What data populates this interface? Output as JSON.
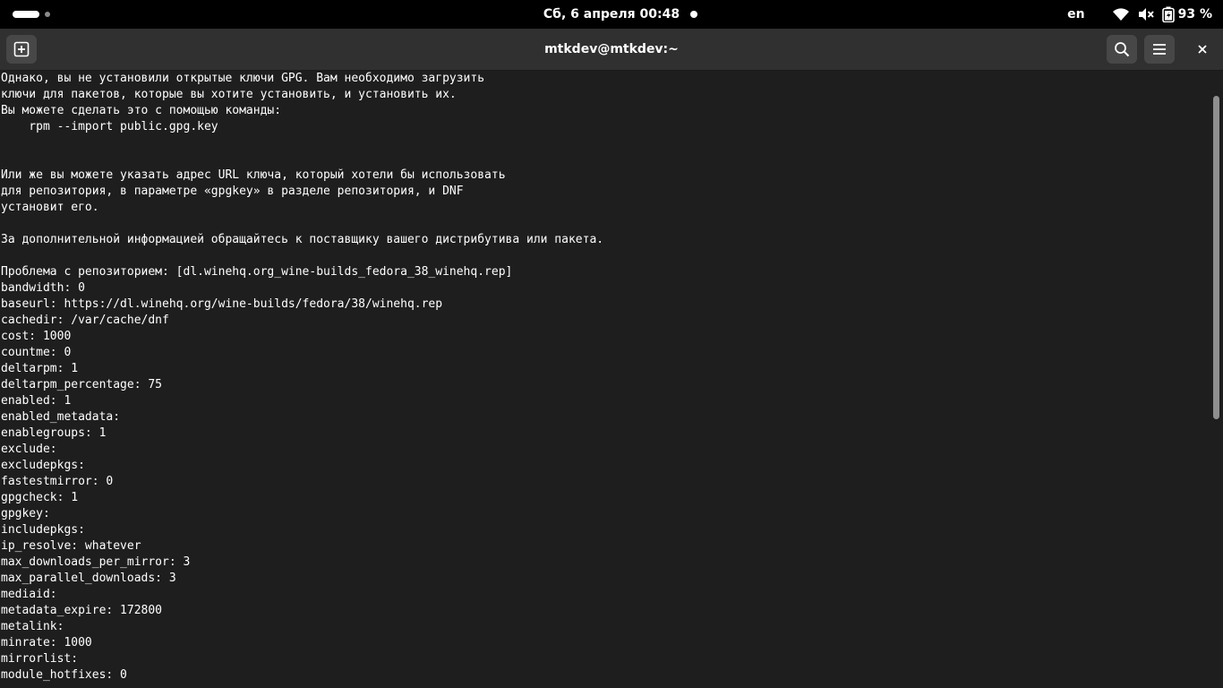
{
  "topbar": {
    "clock": "Сб, 6 апреля  00:48",
    "language": "en",
    "battery": "93 %"
  },
  "window": {
    "title": "mtkdev@mtkdev:~"
  },
  "terminal": {
    "lines": [
      "Однако, вы не установили открытые ключи GPG. Вам необходимо загрузить",
      "ключи для пакетов, которые вы хотите установить, и установить их.",
      "Вы можете сделать это с помощью команды:",
      "    rpm --import public.gpg.key",
      "",
      "",
      "Или же вы можете указать адрес URL ключа, который хотели бы использовать",
      "для репозитория, в параметре «gpgkey» в разделе репозитория, и DNF",
      "установит его.",
      "",
      "За дополнительной информацией обращайтесь к поставщику вашего дистрибутива или пакета.",
      "",
      "Проблема с репозиторием: [dl.winehq.org_wine-builds_fedora_38_winehq.rep]",
      "bandwidth: 0",
      "baseurl: https://dl.winehq.org/wine-builds/fedora/38/winehq.rep",
      "cachedir: /var/cache/dnf",
      "cost: 1000",
      "countme: 0",
      "deltarpm: 1",
      "deltarpm_percentage: 75",
      "enabled: 1",
      "enabled_metadata:",
      "enablegroups: 1",
      "exclude:",
      "excludepkgs:",
      "fastestmirror: 0",
      "gpgcheck: 1",
      "gpgkey:",
      "includepkgs:",
      "ip_resolve: whatever",
      "max_downloads_per_mirror: 3",
      "max_parallel_downloads: 3",
      "mediaid:",
      "metadata_expire: 172800",
      "metalink:",
      "minrate: 1000",
      "mirrorlist:",
      "module_hotfixes: 0"
    ]
  },
  "scrollbar": {
    "position": 0.06,
    "visible_fraction": 0.54
  }
}
